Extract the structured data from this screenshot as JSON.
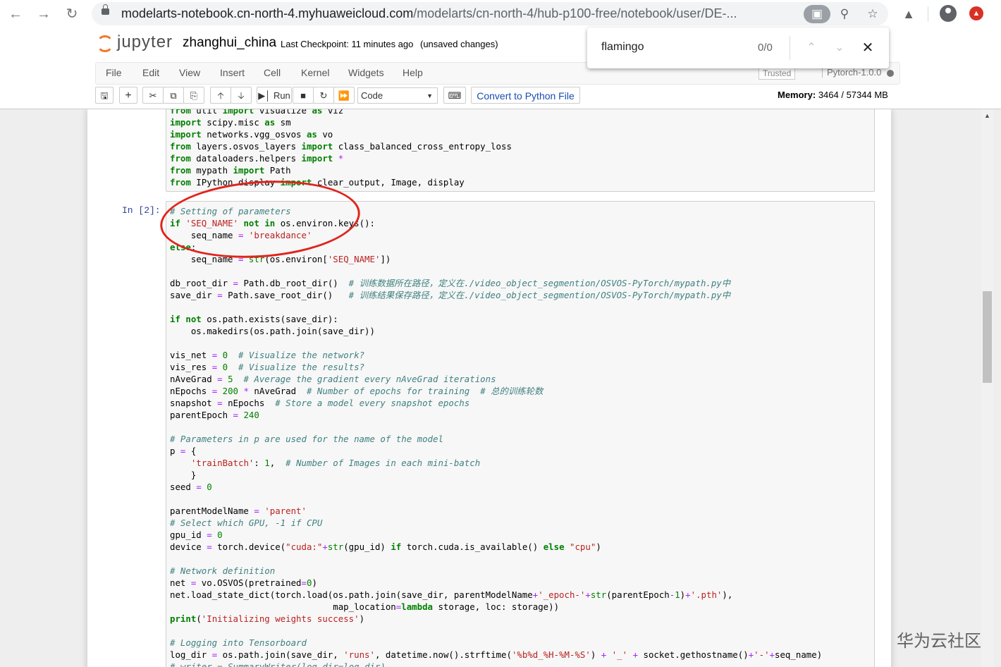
{
  "browser": {
    "url_main": "modelarts-notebook.cn-north-4.myhuaweicloud.com",
    "url_path": "/modelarts/cn-north-4/hub-p100-free/notebook/user/DE-..."
  },
  "find": {
    "query": "flamingo",
    "count": "0/0"
  },
  "jupyter": {
    "logo_text": "jupyter",
    "notebook_name": "zhanghui_china",
    "checkpoint": "Last Checkpoint: 11 minutes ago",
    "unsaved": "(unsaved changes)",
    "menu": [
      "File",
      "Edit",
      "View",
      "Insert",
      "Cell",
      "Kernel",
      "Widgets",
      "Help"
    ],
    "trusted": "Trusted",
    "kernel": "Pytorch-1.0.0",
    "toolbar": {
      "run_label": "Run",
      "cell_type": "Code",
      "convert_label": "Convert to Python File",
      "memory_label": "Memory:",
      "memory_value": "3464 / 57344 MB"
    }
  },
  "cell1_lines": [
    "from util import visualize as viz",
    "import scipy.misc as sm",
    "import networks.vgg_osvos as vo",
    "from layers.osvos_layers import class_balanced_cross_entropy_loss",
    "from dataloaders.helpers import *",
    "from mypath import Path",
    "from IPython.display import clear_output, Image, display"
  ],
  "cell2": {
    "prompt": "In  [2]:",
    "lines": [
      "# Setting of parameters",
      "if 'SEQ_NAME' not in os.environ.keys():",
      "    seq_name = 'breakdance'",
      "else:",
      "    seq_name = str(os.environ['SEQ_NAME'])",
      "",
      "db_root_dir = Path.db_root_dir()  # 训练数据所在路径，定义在./video_object_segmention/OSVOS-PyTorch/mypath.py中",
      "save_dir = Path.save_root_dir()   # 训练结果保存路径，定义在./video_object_segmention/OSVOS-PyTorch/mypath.py中",
      "",
      "if not os.path.exists(save_dir):",
      "    os.makedirs(os.path.join(save_dir))",
      "",
      "vis_net = 0  # Visualize the network?",
      "vis_res = 0  # Visualize the results?",
      "nAveGrad = 5  # Average the gradient every nAveGrad iterations",
      "nEpochs = 200 * nAveGrad  # Number of epochs for training  # 总的训练轮数",
      "snapshot = nEpochs  # Store a model every snapshot epochs",
      "parentEpoch = 240",
      "",
      "# Parameters in p are used for the name of the model",
      "p = {",
      "    'trainBatch': 1,  # Number of Images in each mini-batch",
      "    }",
      "seed = 0",
      "",
      "parentModelName = 'parent'",
      "# Select which GPU, -1 if CPU",
      "gpu_id = 0",
      "device = torch.device(\"cuda:\"+str(gpu_id) if torch.cuda.is_available() else \"cpu\")",
      "",
      "# Network definition",
      "net = vo.OSVOS(pretrained=0)",
      "net.load_state_dict(torch.load(os.path.join(save_dir, parentModelName+'_epoch-'+str(parentEpoch-1)+'.pth'),",
      "                               map_location=lambda storage, loc: storage))",
      "print('Initializing weights success')",
      "",
      "# Logging into Tensorboard",
      "log_dir = os.path.join(save_dir, 'runs', datetime.now().strftime('%b%d_%H-%M-%S') + '_' + socket.gethostname()+'-'+seq_name)",
      "# writer = SummaryWriter(log_dir=log_dir)"
    ]
  },
  "watermark": "华为云社区"
}
